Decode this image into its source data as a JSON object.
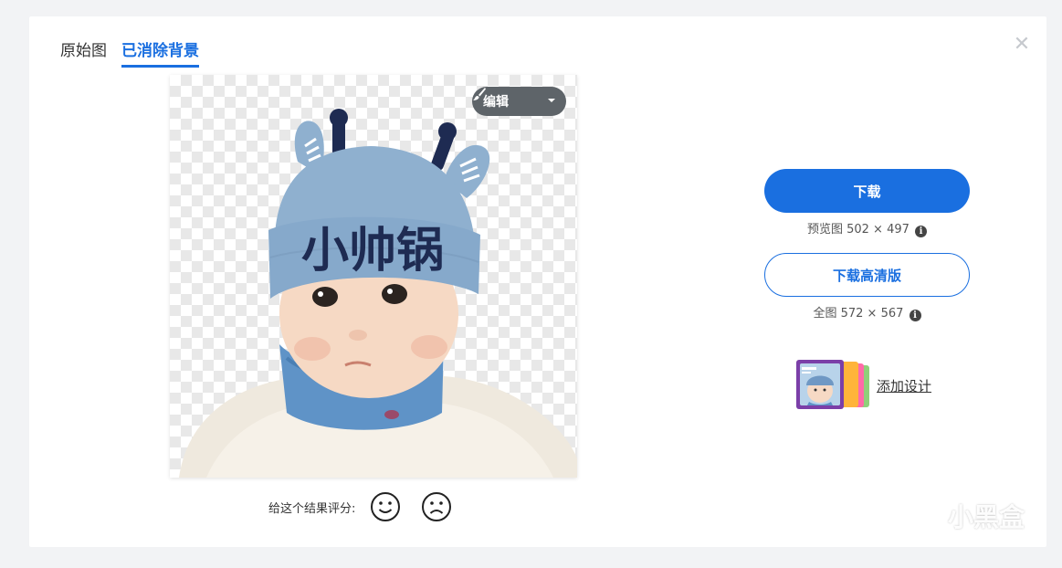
{
  "tabs": [
    {
      "label": "原始图",
      "active": false
    },
    {
      "label": "已消除背景",
      "active": true
    }
  ],
  "close_icon": "close-icon",
  "editor": {
    "edit_label": "编辑",
    "hat_text": "小帅锅"
  },
  "rating": {
    "label": "给这个结果评分:",
    "positive_icon": "smile-icon",
    "negative_icon": "frown-icon"
  },
  "download": {
    "button_label": "下载",
    "preview_label": "预览图 502 × 497",
    "hd_button_label": "下载高清版",
    "full_label": "全图 572 × 567"
  },
  "design": {
    "link_label": "添加设计"
  },
  "watermark": {
    "text": "小黑盒"
  },
  "colors": {
    "accent": "#1a6fe0",
    "edit_button": "#5e6469",
    "hat": "#8fb0cf",
    "scarf": "#5f93c7"
  }
}
